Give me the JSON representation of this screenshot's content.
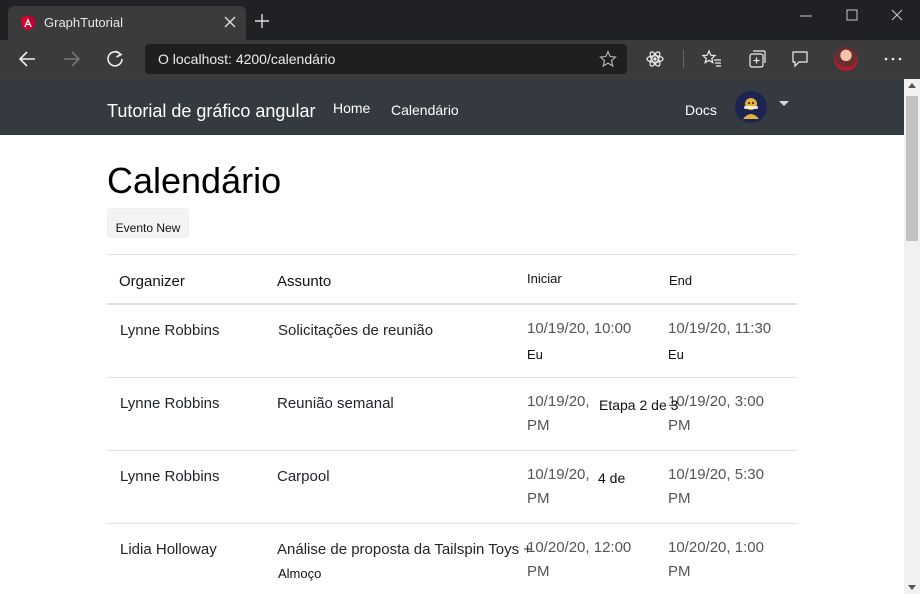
{
  "browser": {
    "tab_title": "GraphTutorial",
    "address": "O localhost: 4200/calendário"
  },
  "navbar": {
    "brand": "Tutorial de gráfico angular",
    "links": [
      "Home",
      "Calendário"
    ],
    "docs": "Docs"
  },
  "page": {
    "title": "Calendário",
    "new_event_button": "Evento New"
  },
  "table": {
    "headers": [
      "Organizer",
      "Assunto",
      "Iniciar",
      "End"
    ],
    "rows": [
      {
        "organizer": "Lynne Robbins",
        "subject": "Solicitações de reunião",
        "start": "10/19/20, 10:00",
        "start2": "Eu",
        "end": "10/19/20, 11:30",
        "end2": "Eu"
      },
      {
        "organizer": "Lynne Robbins",
        "subject": "Reunião semanal",
        "start": "10/19/20,",
        "start2": "PM",
        "end": "10/19/20, 3:00",
        "end2": "PM"
      },
      {
        "organizer": "Lynne Robbins",
        "subject": "Carpool",
        "start": "10/19/20,",
        "start2": "PM",
        "end": "10/19/20, 5:30",
        "end2": "PM"
      },
      {
        "organizer": "Lidia Holloway",
        "subject": "Análise de proposta da Tailspin Toys +",
        "subject2": "Almoço",
        "start": "10/20/20, 12:00",
        "start2": "PM",
        "end": "10/20/20, 1:00",
        "end2": "PM"
      }
    ]
  },
  "overlays": {
    "step_text": "Etapa 2 de 3",
    "step_text2": "4 de"
  }
}
